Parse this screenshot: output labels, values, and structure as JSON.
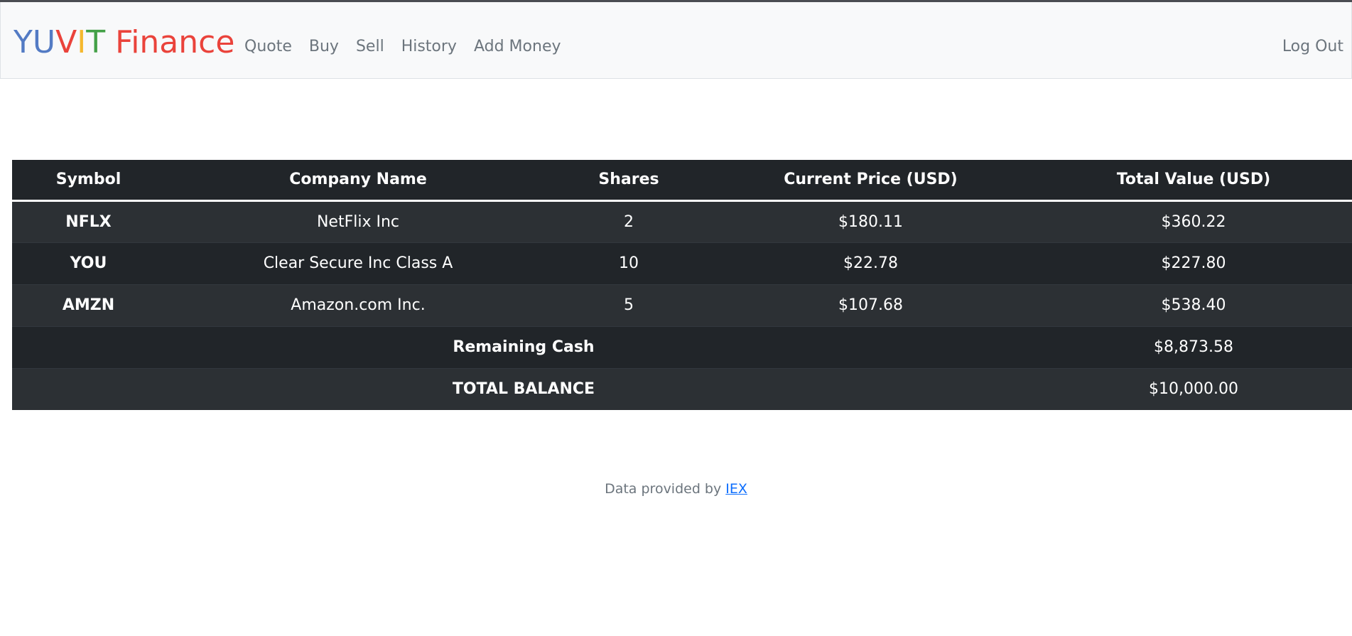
{
  "brand": {
    "letters": [
      "Y",
      "U",
      "V",
      "I",
      "T"
    ],
    "rest": " Finance",
    "colors": [
      "#537bc4",
      "#537bc4",
      "#ea433b",
      "#f5b82e",
      "#43a047",
      "#ea433b"
    ]
  },
  "nav": {
    "items": [
      {
        "label": "Quote"
      },
      {
        "label": "Buy"
      },
      {
        "label": "Sell"
      },
      {
        "label": "History"
      },
      {
        "label": "Add Money"
      }
    ],
    "logout_label": "Log Out"
  },
  "table": {
    "headers": {
      "symbol": "Symbol",
      "company": "Company Name",
      "shares": "Shares",
      "price": "Current Price (USD)",
      "total": "Total Value (USD)"
    },
    "rows": [
      {
        "symbol": "NFLX",
        "company": "NetFlix Inc",
        "shares": "2",
        "price": "$180.11",
        "total": "$360.22"
      },
      {
        "symbol": "YOU",
        "company": "Clear Secure Inc Class A",
        "shares": "10",
        "price": "$22.78",
        "total": "$227.80"
      },
      {
        "symbol": "AMZN",
        "company": "Amazon.com Inc.",
        "shares": "5",
        "price": "$107.68",
        "total": "$538.40"
      }
    ],
    "cash": {
      "label": "Remaining Cash",
      "value": "$8,873.58"
    },
    "balance": {
      "label": "TOTAL BALANCE",
      "value": "$10,000.00"
    }
  },
  "footer": {
    "text": "Data provided by ",
    "link_label": "IEX"
  },
  "colors": {
    "navbar_bg": "#f8f9fa",
    "table_dark": "#212529",
    "table_stripe": "#2c3034",
    "muted_text": "#6c757d",
    "link": "#0d6efd"
  }
}
